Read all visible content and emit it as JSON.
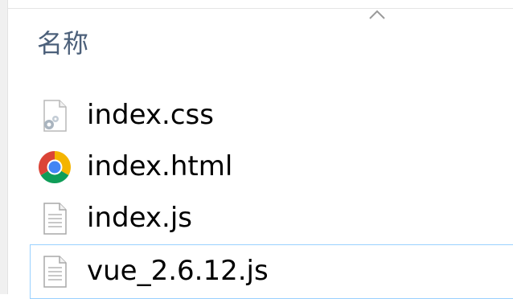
{
  "header": {
    "column_name": "名称",
    "sort_icon": "chevron-up-icon"
  },
  "files": [
    {
      "name": "index.css",
      "icon": "css-file-icon"
    },
    {
      "name": "index.html",
      "icon": "chrome-icon"
    },
    {
      "name": "index.js",
      "icon": "text-file-icon"
    },
    {
      "name": "vue_2.6.12.js",
      "icon": "text-file-icon",
      "selected": true
    }
  ],
  "colors": {
    "header_text": "#4c607a",
    "selection_border": "#99d1ff",
    "chrome_red": "#db4437",
    "chrome_green": "#0f9d58",
    "chrome_yellow": "#f4b400",
    "chrome_blue": "#4285f4"
  }
}
